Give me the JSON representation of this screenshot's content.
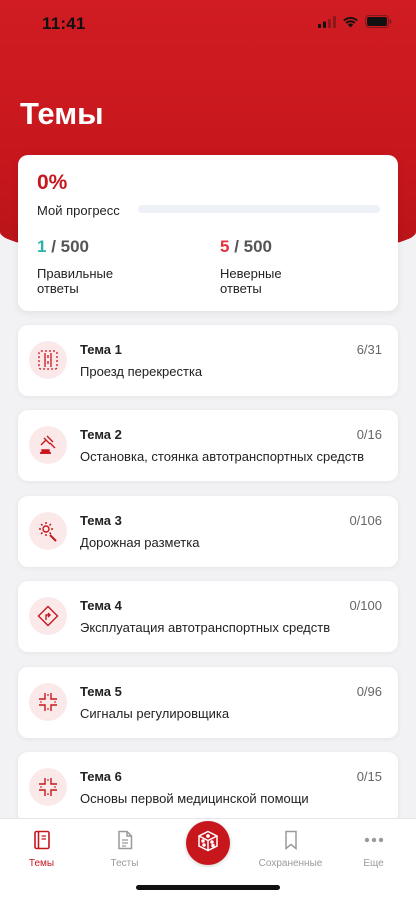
{
  "status": {
    "time": "11:41"
  },
  "header": {
    "title": "Темы"
  },
  "progress": {
    "percent_text": "0%",
    "percent_value": 0,
    "label": "Мой прогресс",
    "correct": {
      "count": "1",
      "total": " / 500",
      "label": "Правильные ответы"
    },
    "wrong": {
      "count": "5",
      "total": " / 500",
      "label": "Неверные ответы"
    }
  },
  "topics": [
    {
      "num": "Тема 1",
      "name": "Проезд перекрестка",
      "count": "6/31",
      "icon": "intersection-icon"
    },
    {
      "num": "Тема 2",
      "name": "Остановка, стоянка автотранспортных средств",
      "count": "0/16",
      "icon": "gavel-icon"
    },
    {
      "num": "Тема 3",
      "name": "Дорожная разметка",
      "count": "0/106",
      "icon": "gear-wrench-icon"
    },
    {
      "num": "Тема 4",
      "name": "Эксплуатация автотранспортных средств",
      "count": "0/100",
      "icon": "road-sign-icon"
    },
    {
      "num": "Тема 5",
      "name": "Сигналы регулировщика",
      "count": "0/96",
      "icon": "crossroads-icon"
    },
    {
      "num": "Тема 6",
      "name": "Основы первой медицинской помощи",
      "count": "0/15",
      "icon": "crossroads-icon"
    }
  ],
  "tabbar": {
    "items": [
      {
        "label": "Темы",
        "icon": "book-icon",
        "active": true
      },
      {
        "label": "Тесты",
        "icon": "document-icon",
        "active": false
      },
      {
        "label": "",
        "icon": "dice-icon",
        "active": false
      },
      {
        "label": "Сохраненные",
        "icon": "bookmark-icon",
        "active": false
      },
      {
        "label": "Еще",
        "icon": "more-icon",
        "active": false
      }
    ]
  },
  "colors": {
    "accent": "#c7171d",
    "correct": "#2bb3a8",
    "wrong": "#e0343c"
  }
}
